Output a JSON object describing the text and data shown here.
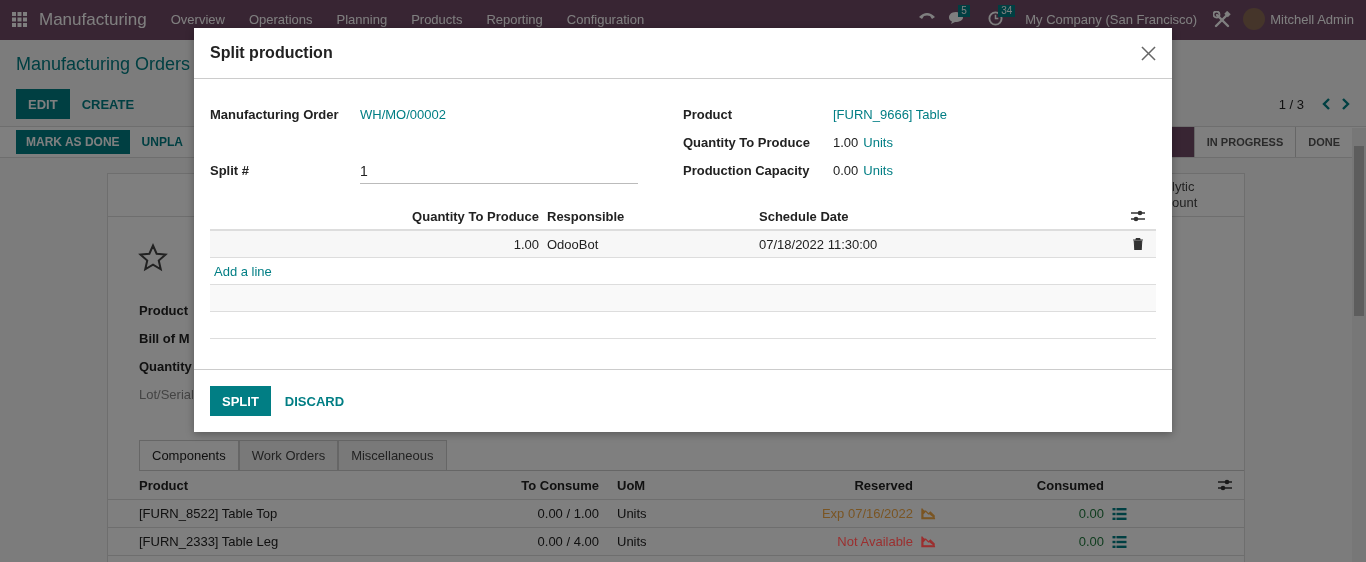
{
  "navbar": {
    "app_name": "Manufacturing",
    "menu": [
      "Overview",
      "Operations",
      "Planning",
      "Products",
      "Reporting",
      "Configuration"
    ],
    "messages_count": "5",
    "activities_count": "34",
    "company": "My Company (San Francisco)",
    "user": "Mitchell Admin"
  },
  "control_panel": {
    "breadcrumb": "Manufacturing Orders",
    "buttons": [
      {
        "label": "EDIT",
        "kind": "primary"
      },
      {
        "label": "CREATE",
        "kind": "secondary"
      }
    ],
    "pager": "1 / 3",
    "actions": [
      {
        "label": "MARK AS DONE",
        "kind": "primary"
      },
      {
        "label": "UNPLA",
        "kind": "secondary"
      }
    ],
    "stages": [
      {
        "selected": true
      },
      {
        "label": "IN PROGRESS",
        "selected": false
      },
      {
        "label": "DONE",
        "selected": false
      }
    ]
  },
  "sheet": {
    "smart_button_lines": [
      "lytic",
      "ount"
    ],
    "starred": false,
    "fields": [
      {
        "label": "Product",
        "muted": false
      },
      {
        "label": "Bill of M",
        "muted": false
      },
      {
        "label": "Quantity",
        "muted": false
      },
      {
        "label": "Lot/Serial",
        "muted": true
      }
    ],
    "tabs": [
      {
        "label": "Components",
        "selected": true
      },
      {
        "label": "Work Orders",
        "selected": false
      },
      {
        "label": "Miscellaneous",
        "selected": false
      }
    ],
    "columns": [
      "Product",
      "To Consume",
      "UoM",
      "Reserved",
      "Consumed"
    ],
    "rows": [
      {
        "product": "[FURN_8522] Table Top",
        "to_consume": "0.00 / 1.00",
        "uom": "Units",
        "reserved": "Exp 07/16/2022",
        "color": "#7a5523",
        "consumed": "0.00"
      },
      {
        "product": "[FURN_2333] Table Leg",
        "to_consume": "0.00 / 4.00",
        "uom": "Units",
        "reserved": "Not Available",
        "color": "#9b2f2f",
        "consumed": "0.00"
      }
    ]
  },
  "dialog": {
    "title": "Split production",
    "left_fields": [
      {
        "label": "Manufacturing Order",
        "kind": "link",
        "value": "WH/MO/00002"
      },
      {
        "label": "Split #",
        "kind": "input",
        "value": "1"
      }
    ],
    "right_fields": [
      {
        "label": "Product",
        "kind": "link",
        "value": "[FURN_9666] Table"
      },
      {
        "label": "Quantity To Produce",
        "kind": "quantity",
        "value": "1.00",
        "unit": "Units"
      },
      {
        "label": "Production Capacity",
        "kind": "quantity",
        "value": "0.00",
        "unit": "Units"
      }
    ],
    "lines": {
      "columns": [
        "Quantity To Produce",
        "Responsible",
        "Schedule Date"
      ],
      "rows": [
        {
          "quantity": "1.00",
          "responsible": "OdooBot",
          "date": "07/18/2022 11:30:00"
        }
      ],
      "add_line": "Add a line"
    },
    "buttons": [
      {
        "label": "SPLIT",
        "kind": "primary"
      },
      {
        "label": "DISCARD",
        "kind": "secondary"
      }
    ]
  }
}
